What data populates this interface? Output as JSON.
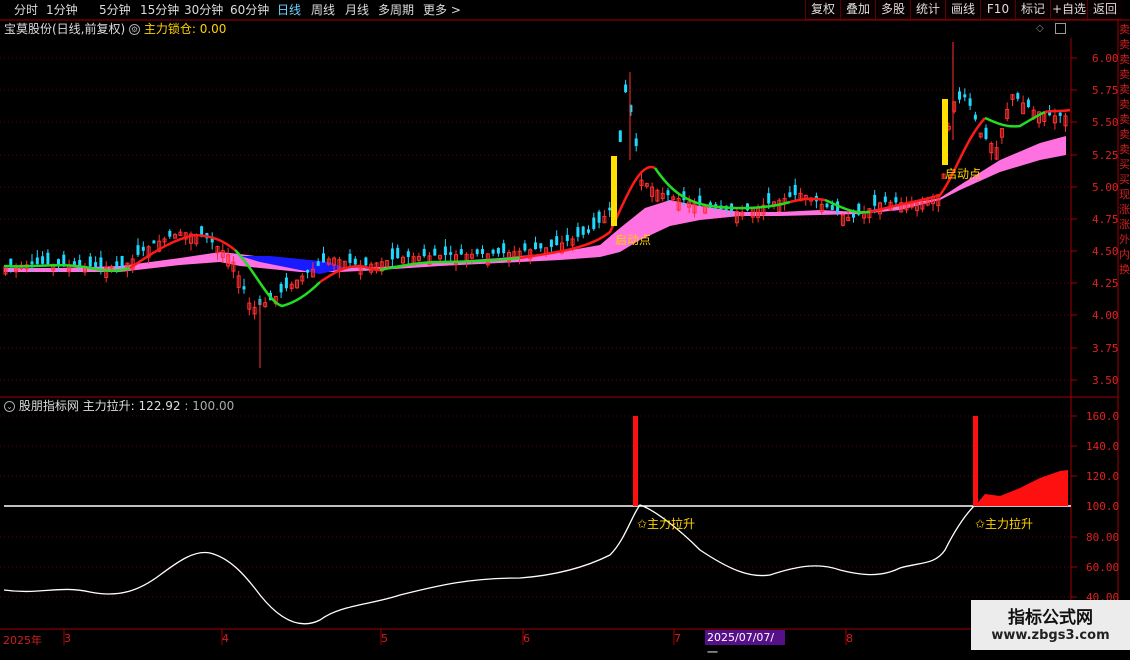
{
  "toolbar": {
    "periods": [
      "分时",
      "1分钟",
      "5分钟",
      "15分钟",
      "30分钟",
      "60分钟",
      "日线",
      "周线",
      "月线",
      "多周期",
      "更多"
    ],
    "active_period": "日线",
    "right_buttons": [
      "复权",
      "叠加",
      "多股",
      "统计",
      "画线",
      "F10",
      "标记",
      "+自选",
      "返回"
    ]
  },
  "main_panel": {
    "stock_title": "宝莫股份(日线,前复权)",
    "indicator_label": "主力锁仓:",
    "indicator_value": "0.00",
    "y_ticks": [
      "6.00",
      "5.75",
      "5.50",
      "5.25",
      "5.00",
      "4.75",
      "4.50",
      "4.25",
      "4.00",
      "3.75",
      "3.50"
    ],
    "annotations": [
      "启动点",
      "启动点"
    ]
  },
  "indicator_panel": {
    "title": "股朋指标网",
    "label": "主力拉升:",
    "value1": "122.92",
    "value2": "100.00",
    "y_ticks": [
      "160.0",
      "140.0",
      "120.0",
      "100.0",
      "80.00",
      "60.00",
      "40.00"
    ],
    "annotations": [
      "✩主力拉升",
      "✩主力拉升"
    ]
  },
  "x_axis": {
    "labels": [
      "2025年",
      "3",
      "4",
      "5",
      "6",
      "7",
      "8"
    ],
    "cursor_date": "2025/07/07/一"
  },
  "side_panel_text": "卖卖卖卖卖卖卖卖卖买买现涨涨外内换",
  "watermark": {
    "line1": "指标公式网",
    "line2": "www.zbgs3.com"
  },
  "colors": {
    "up": "#ff3030",
    "down": "#20d8ff",
    "ma_red": "#ff1a1a",
    "ma_green": "#22dd22",
    "band_pink": "#ff70e0",
    "band_blue": "#1a1aff",
    "bar_yellow": "#ffe000",
    "grid_red": "#a00000"
  }
}
